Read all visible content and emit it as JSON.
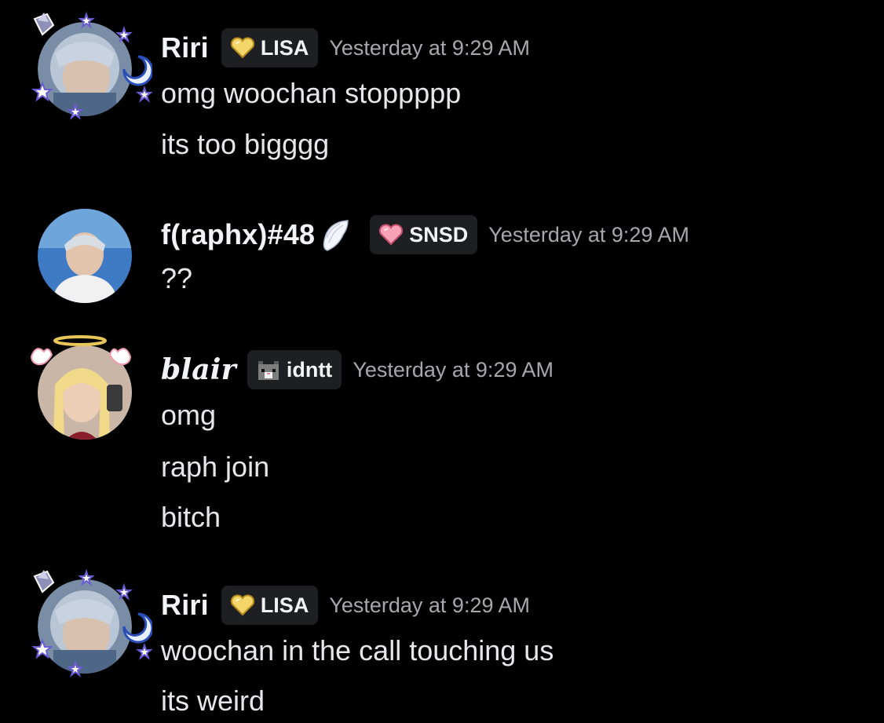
{
  "messages": [
    {
      "username": "Riri",
      "tag": "LISA",
      "tag_icon": "yellow-heart-icon",
      "timestamp": "Yesterday at 9:29 AM",
      "lines": [
        "omg woochan stoppppp",
        "its too bigggg"
      ]
    },
    {
      "username": "f(raphx)#48",
      "username_icon": "angel-wing-icon",
      "tag": "SNSD",
      "tag_icon": "pink-heart-icon",
      "timestamp": "Yesterday at 9:29 AM",
      "lines": [
        "??"
      ]
    },
    {
      "username": "blair",
      "tag": "idntt",
      "tag_icon": "pixel-cat-icon",
      "timestamp": "Yesterday at 9:29 AM",
      "lines": [
        "omg",
        "raph join",
        "bitch"
      ]
    },
    {
      "username": "Riri",
      "tag": "LISA",
      "tag_icon": "yellow-heart-icon",
      "timestamp": "Yesterday at 9:29 AM",
      "lines": [
        "woochan in the call touching us",
        "its weird"
      ]
    }
  ],
  "colors": {
    "background": "#000000",
    "tag_background": "#1e1f22",
    "username": "#f2f3f5",
    "timestamp": "#a6a8ad",
    "text": "#e6e7e9"
  }
}
